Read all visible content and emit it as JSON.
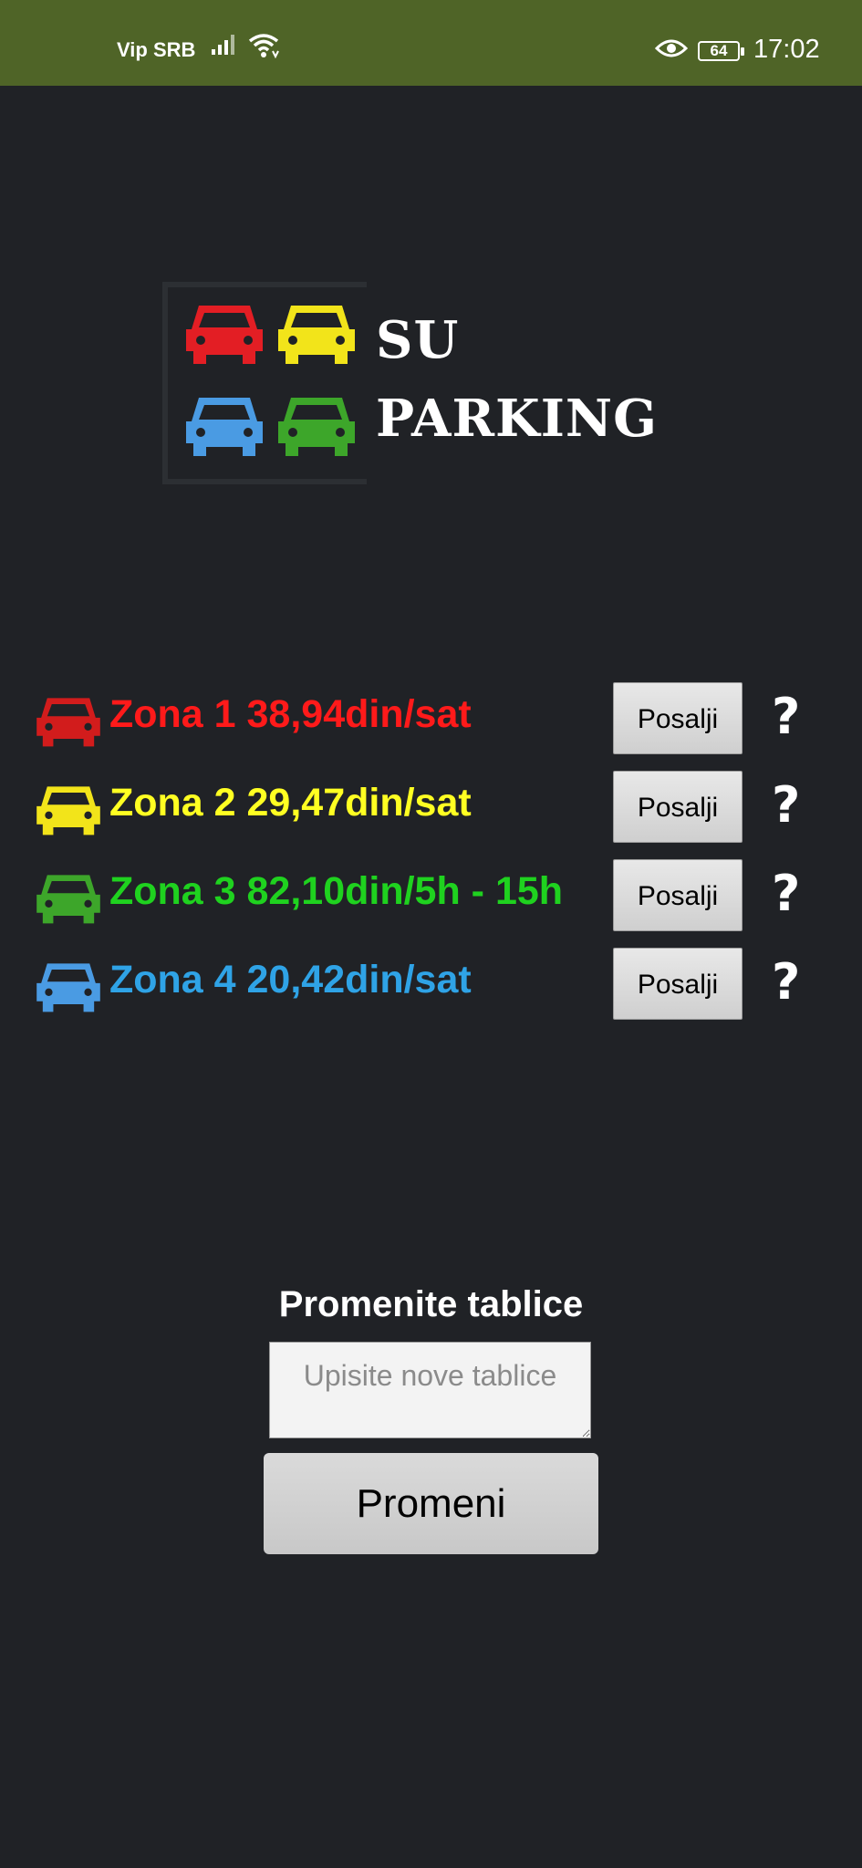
{
  "status_bar": {
    "carrier": "Vip SRB",
    "battery": "64",
    "time": "17:02",
    "icons": [
      "signal-icon",
      "wifi-icon",
      "eye-icon",
      "battery-icon"
    ]
  },
  "logo": {
    "line1": "SU",
    "line2": "PARKING",
    "car_colors": [
      "#e31e24",
      "#f2e41a",
      "#4a9be3",
      "#3da62a"
    ]
  },
  "zones": [
    {
      "label": "Zona 1  38,94din/sat",
      "color": "#ff1a1a",
      "icon_color": "#d21c1c",
      "button": "Posalji",
      "help": "?"
    },
    {
      "label": "Zona 2 29,47din/sat",
      "color": "#ffff22",
      "icon_color": "#f2e41a",
      "button": "Posalji",
      "help": "?"
    },
    {
      "label": "Zona 3 82,10din/5h - 15h",
      "color": "#1fd21f",
      "icon_color": "#3da62a",
      "button": "Posalji",
      "help": "?"
    },
    {
      "label": "Zona 4 20,42din/sat",
      "color": "#2fa3e6",
      "icon_color": "#4a9be3",
      "button": "Posalji",
      "help": "?"
    }
  ],
  "plates": {
    "title": "Promenite tablice",
    "input_placeholder": "Upisite nove tablice",
    "input_value": "",
    "button": "Promeni"
  }
}
